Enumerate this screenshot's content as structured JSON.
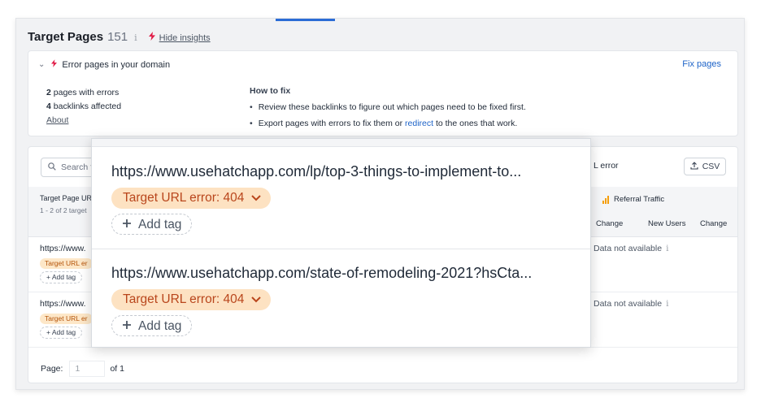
{
  "header": {
    "title": "Target Pages",
    "count": "151",
    "info": "i",
    "hide_insights": "Hide insights"
  },
  "insight": {
    "heading": "Error pages in your domain",
    "fix_pages": "Fix pages",
    "stat1_num": "2",
    "stat1_text": "pages with errors",
    "stat2_num": "4",
    "stat2_text": "backlinks affected",
    "about": "About",
    "howto_title": "How to fix",
    "tip1": "Review these backlinks to figure out which pages need to be fixed first.",
    "tip2_pre": "Export pages with errors to fix them or",
    "tip2_link": "redirect",
    "tip2_post": "to the ones that work."
  },
  "table": {
    "search_placeholder": "Search f",
    "error_fragment": "L error",
    "csv_label": "CSV",
    "col_page": "Target Page UR",
    "col_page_sub": "1 - 2 of 2 target",
    "col_referral": "Referral Traffic",
    "col_change": "Change",
    "col_new_users": "New Users",
    "col_change2": "Change",
    "rows": [
      {
        "url": "https://www.",
        "error": "Target URL er",
        "add_tag": "Add tag",
        "na": "Data not available"
      },
      {
        "url": "https://www.",
        "error": "Target URL er",
        "add_tag": "Add tag",
        "na": "Data not available"
      }
    ],
    "pager_label": "Page:",
    "pager_value": "1",
    "pager_of": "of 1"
  },
  "popup": {
    "items": [
      {
        "url": "https://www.usehatchapp.com/lp/top-3-things-to-implement-to...",
        "error": "Target URL error: 404",
        "add_tag": "Add tag"
      },
      {
        "url": "https://www.usehatchapp.com/state-of-remodeling-2021?hsCta...",
        "error": "Target URL error: 404",
        "add_tag": "Add tag"
      }
    ]
  },
  "colors": {
    "accent": "#2b6cd6",
    "error_bg": "#fde2c2",
    "error_text": "#b9461c",
    "bolt": "#e11d48",
    "link": "#1d63c8"
  },
  "icons": [
    "bolt-icon",
    "chevron-down-icon",
    "search-icon",
    "upload-icon",
    "bar-chart-icon",
    "plus-icon",
    "info-icon"
  ]
}
